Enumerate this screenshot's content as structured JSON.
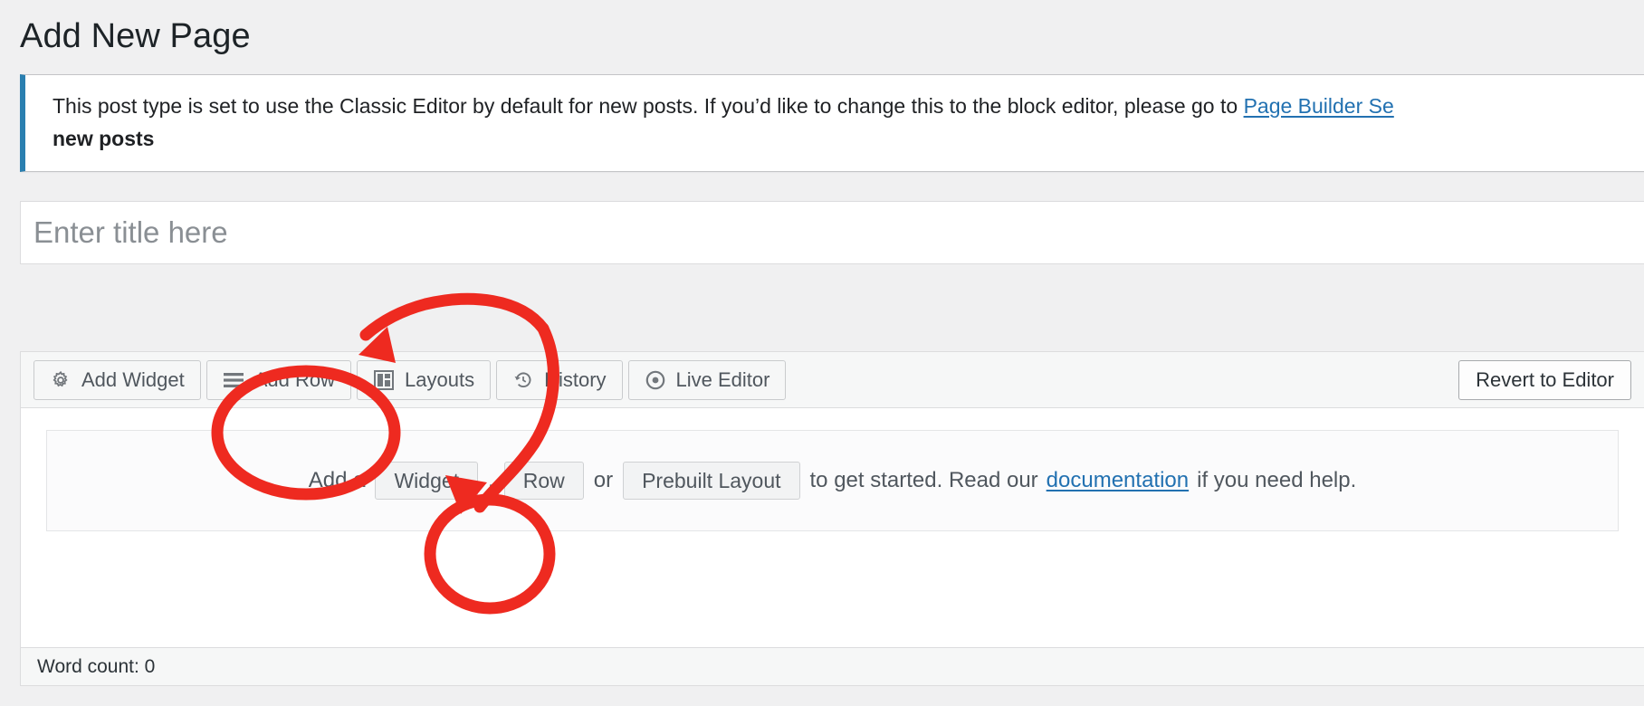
{
  "page": {
    "title": "Add New Page"
  },
  "notice": {
    "text_before_link": "This post type is set to use the Classic Editor by default for new posts. If you’d like to change this to the block editor, please go to ",
    "link_text": "Page Builder Se",
    "text_bold_second_line": "new posts",
    "accent_color": "#2a7fb0"
  },
  "title_field": {
    "placeholder": "Enter title here",
    "value": ""
  },
  "toolbar": {
    "buttons": [
      {
        "label": "Add Widget",
        "icon": "gear-icon"
      },
      {
        "label": "Add Row",
        "icon": "hamburger-rows-icon"
      },
      {
        "label": "Layouts",
        "icon": "layout-grid-icon"
      },
      {
        "label": "History",
        "icon": "history-revert-icon"
      },
      {
        "label": "Live Editor",
        "icon": "eye-icon"
      }
    ],
    "revert_label": "Revert to Editor"
  },
  "stage": {
    "prefix": "Add a",
    "widget_chip": "Widget",
    "comma": ",",
    "row_chip": "Row",
    "or": "or",
    "prebuilt_chip": "Prebuilt Layout",
    "middle": "to get started. Read our",
    "doc_link": "documentation",
    "suffix": "if you need help."
  },
  "status": {
    "word_count": "Word count: 0"
  },
  "annotations": {
    "color": "#ee2a20",
    "items": [
      {
        "shape": "ellipse",
        "target": "add-row-button"
      },
      {
        "shape": "ellipse",
        "target": "row-chip"
      },
      {
        "shape": "curved-arrow",
        "from": "toolbar-right",
        "to": "add-row-button-above"
      },
      {
        "shape": "curved-arrow",
        "from": "toolbar-top",
        "to": "row-chip-above"
      }
    ]
  }
}
